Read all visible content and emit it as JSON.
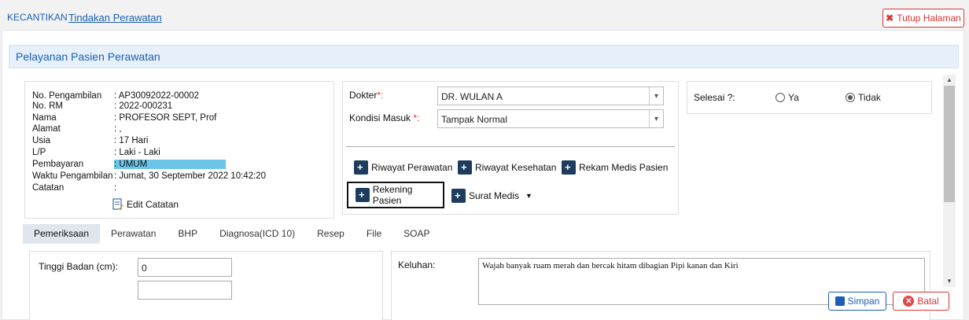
{
  "breadcrumb": {
    "root": "KECANTIKAN",
    "current": "Tindakan Perawatan"
  },
  "close_button": "Tutup Halaman",
  "panel_title": "Pelayanan Pasien Perawatan",
  "patient": [
    {
      "label": "No. Pengambilan",
      "value": ": AP30092022-00002"
    },
    {
      "label": "No. RM",
      "value": ": 2022-000231"
    },
    {
      "label": "Nama",
      "value": ": PROFESOR SEPT, Prof"
    },
    {
      "label": "Alamat",
      "value": ": ,"
    },
    {
      "label": "Usia",
      "value": ": 17 Hari"
    },
    {
      "label": "L/P",
      "value": ": Laki - Laki"
    },
    {
      "label": "Pembayaran",
      "value": ": UMUM"
    },
    {
      "label": "Waktu Pengambilan",
      "value": ": Jumat, 30 September 2022 10:42:20"
    },
    {
      "label": "Catatan",
      "value": ":"
    }
  ],
  "edit_note": "Edit Catatan",
  "doctor": {
    "label": "Dokter",
    "required": "*:",
    "value": "DR. WULAN A"
  },
  "condition": {
    "label": "Kondisi Masuk ",
    "required": "*:",
    "value": "Tampak Normal"
  },
  "actions": {
    "riwayat_perawatan": "Riwayat Perawatan",
    "riwayat_kesehatan": "Riwayat Kesehatan",
    "rekam_medis": "Rekam Medis Pasien",
    "rekening": "Rekening Pasien",
    "surat_medis": "Surat Medis"
  },
  "done": {
    "label": "Selesai ?:",
    "yes": "Ya",
    "no": "Tidak",
    "selected": "Tidak"
  },
  "tabs": [
    "Pemeriksaan",
    "Perawatan",
    "BHP",
    "Diagnosa(ICD 10)",
    "Resep",
    "File",
    "SOAP"
  ],
  "active_tab": "Pemeriksaan",
  "exam": {
    "height_label": "Tinggi Badan (cm):",
    "height_value": "0",
    "complaint_label": "Keluhan:",
    "complaint_value": "Wajah banyak ruam merah dan bercak hitam dibagian Pipi kanan dan Kiri"
  },
  "footer": {
    "save": "Simpan",
    "cancel": "Batal"
  },
  "colors": {
    "accent": "#1a5fb4",
    "danger": "#d33",
    "highlight": "#6cc4e8"
  }
}
